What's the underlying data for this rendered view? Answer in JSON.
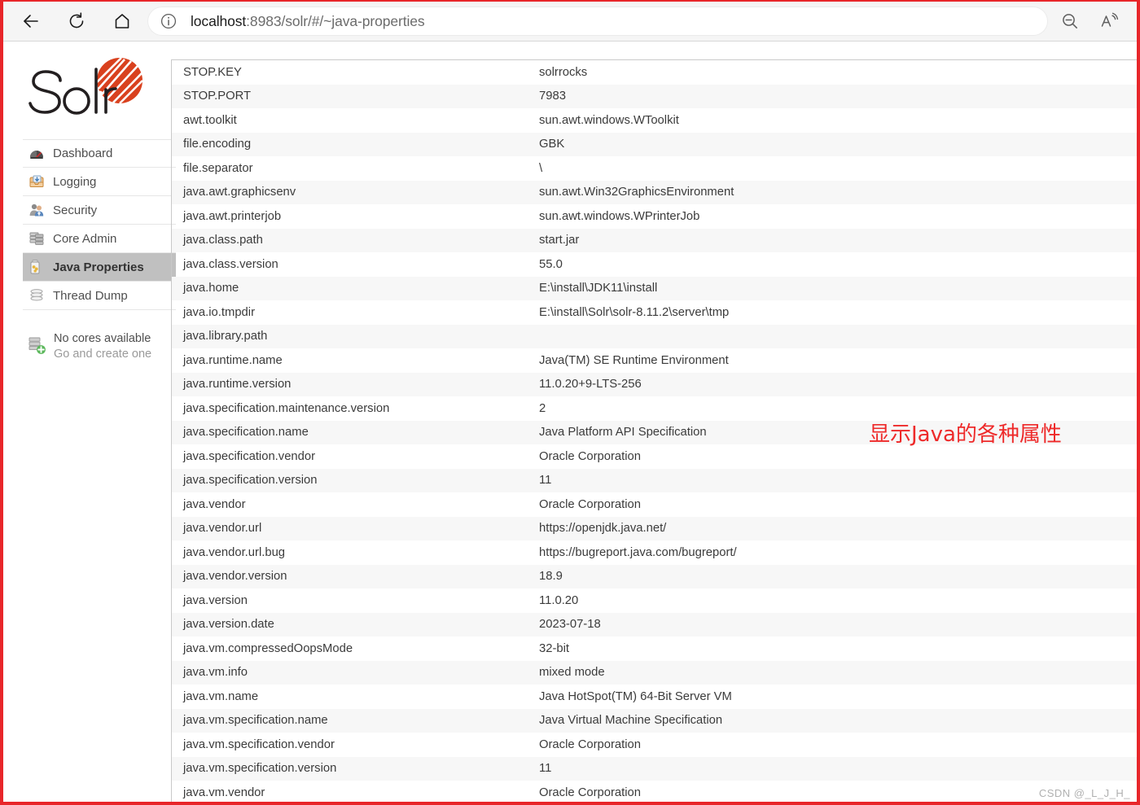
{
  "browser": {
    "back_label": "Back",
    "refresh_label": "Refresh",
    "home_label": "Home",
    "url_host": "localhost",
    "url_rest": ":8983/solr/#/~java-properties",
    "url_full": "localhost:8983/solr/#/~java-properties",
    "info_icon": "info-icon",
    "zoom_out_icon": "zoom-out-icon",
    "read_aloud_icon": "read-aloud-icon"
  },
  "sidebar": {
    "logo_text": "Solr",
    "items": [
      {
        "label": "Dashboard",
        "icon": "dashboard-gauge-icon",
        "active": false
      },
      {
        "label": "Logging",
        "icon": "logging-tray-icon",
        "active": false
      },
      {
        "label": "Security",
        "icon": "security-users-icon",
        "active": false
      },
      {
        "label": "Core Admin",
        "icon": "core-admin-db-icon",
        "active": false
      },
      {
        "label": "Java Properties",
        "icon": "java-properties-icon",
        "active": true
      },
      {
        "label": "Thread Dump",
        "icon": "thread-dump-icon",
        "active": false
      }
    ],
    "cores": {
      "icon": "add-core-icon",
      "title": "No cores available",
      "subtitle": "Go and create one"
    }
  },
  "annotation": {
    "text": "显示Java的各种属性",
    "color": "#ee2a2a"
  },
  "watermark": "CSDN @_L_J_H_",
  "colors": {
    "frame_red": "#e8262a",
    "row_stripe": "#f7f7f7",
    "active_nav": "#c0c0c0",
    "solr_red": "#d9411e"
  },
  "table": {
    "rows": [
      {
        "key": "STOP.KEY",
        "value": "solrrocks"
      },
      {
        "key": "STOP.PORT",
        "value": "7983"
      },
      {
        "key": "awt.toolkit",
        "value": "sun.awt.windows.WToolkit"
      },
      {
        "key": "file.encoding",
        "value": "GBK"
      },
      {
        "key": "file.separator",
        "value": "\\"
      },
      {
        "key": "java.awt.graphicsenv",
        "value": "sun.awt.Win32GraphicsEnvironment"
      },
      {
        "key": "java.awt.printerjob",
        "value": "sun.awt.windows.WPrinterJob"
      },
      {
        "key": "java.class.path",
        "value": "start.jar"
      },
      {
        "key": "java.class.version",
        "value": "55.0"
      },
      {
        "key": "java.home",
        "value": "E:\\install\\JDK11\\install"
      },
      {
        "key": "java.io.tmpdir",
        "value": "E:\\install\\Solr\\solr-8.11.2\\server\\tmp"
      },
      {
        "key": "java.library.path",
        "value": ""
      },
      {
        "key": "java.runtime.name",
        "value": "Java(TM) SE Runtime Environment"
      },
      {
        "key": "java.runtime.version",
        "value": "11.0.20+9-LTS-256"
      },
      {
        "key": "java.specification.maintenance.version",
        "value": "2"
      },
      {
        "key": "java.specification.name",
        "value": "Java Platform API Specification"
      },
      {
        "key": "java.specification.vendor",
        "value": "Oracle Corporation"
      },
      {
        "key": "java.specification.version",
        "value": "11"
      },
      {
        "key": "java.vendor",
        "value": "Oracle Corporation"
      },
      {
        "key": "java.vendor.url",
        "value": "https://openjdk.java.net/"
      },
      {
        "key": "java.vendor.url.bug",
        "value": "https://bugreport.java.com/bugreport/"
      },
      {
        "key": "java.vendor.version",
        "value": "18.9"
      },
      {
        "key": "java.version",
        "value": "11.0.20"
      },
      {
        "key": "java.version.date",
        "value": "2023-07-18"
      },
      {
        "key": "java.vm.compressedOopsMode",
        "value": "32-bit"
      },
      {
        "key": "java.vm.info",
        "value": "mixed mode"
      },
      {
        "key": "java.vm.name",
        "value": "Java HotSpot(TM) 64-Bit Server VM"
      },
      {
        "key": "java.vm.specification.name",
        "value": "Java Virtual Machine Specification"
      },
      {
        "key": "java.vm.specification.vendor",
        "value": "Oracle Corporation"
      },
      {
        "key": "java.vm.specification.version",
        "value": "11"
      },
      {
        "key": "java.vm.vendor",
        "value": "Oracle Corporation"
      }
    ]
  }
}
